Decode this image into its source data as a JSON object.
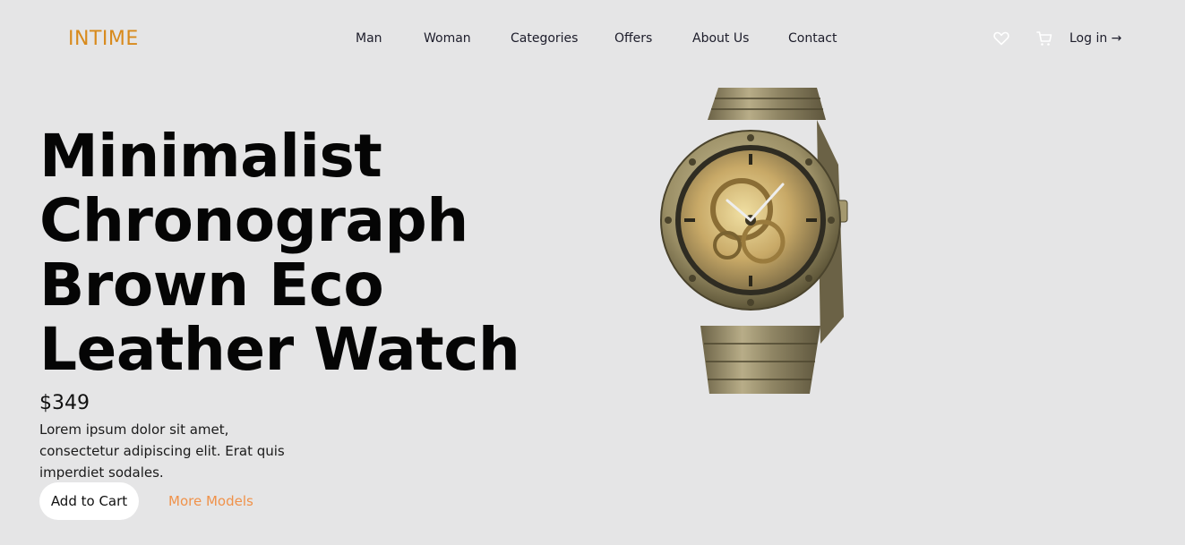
{
  "brand": {
    "logo_text": "INTIME",
    "accent_color": "#d88a1c"
  },
  "nav": {
    "items": [
      {
        "label": "Man"
      },
      {
        "label": "Woman"
      },
      {
        "label": "Categories"
      },
      {
        "label": "Offers"
      },
      {
        "label": "About Us"
      },
      {
        "label": "Contact"
      }
    ],
    "icons": [
      "heart-icon",
      "cart-icon"
    ],
    "login_label": "Log in →"
  },
  "hero": {
    "title_lines": [
      "Minimalist",
      "Chronograph",
      "Brown Eco",
      "Leather Watch"
    ],
    "price": "$349",
    "description": "Lorem ipsum dolor sit amet, consectetur adipiscing elit. Erat quis imperdiet sodales.",
    "add_to_cart_label": "Add to Cart",
    "more_models_label": "More Models",
    "more_models_color": "#f0924a"
  },
  "product_image": {
    "subject": "skeleton-wristwatch-image"
  }
}
